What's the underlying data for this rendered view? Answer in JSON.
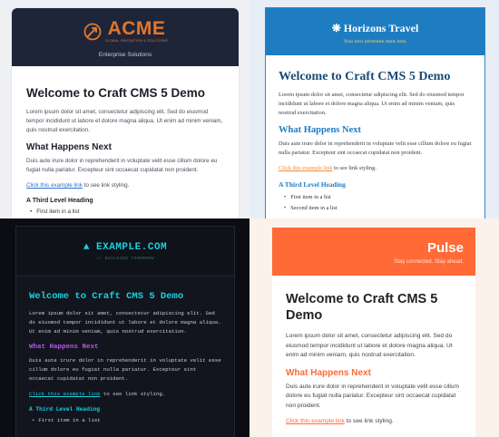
{
  "acme": {
    "logo_word": "ACME",
    "logo_sub": "GLOBAL INNOVATION & SOLUTIONS",
    "tagline": "Enterprise Solutions",
    "heading": "Welcome to Craft CMS 5 Demo",
    "para1": "Lorem ipsum dolor sit amet, consectetur adipiscing elit. Sed do eiusmod tempor incididunt ut labore et dolore magna aliqua. Ut enim ad minim veniam, quis nostrud exercitation.",
    "subheading": "What Happens Next",
    "para2": "Duis aute irure dolor in reprehenderit in voluptate velit esse cillum dolore eu fugiat nulla pariatur. Excepteur sint occaecat cupidatat non proident.",
    "link_text": "Click this example link",
    "link_suffix": " to see link styling.",
    "third_heading": "A Third Level Heading",
    "list": [
      "First item in a list"
    ],
    "accent_color": "#e0772c"
  },
  "horizons": {
    "title": "❋ Horizons Travel",
    "tagline": "Your next adventure starts here.",
    "heading": "Welcome to Craft CMS 5 Demo",
    "para1": "Lorem ipsum dolor sit amet, consectetur adipiscing elit. Sed do eiusmod tempor incididunt ut labore et dolore magna aliqua. Ut enim ad minim veniam, quis nostrud exercitation.",
    "subheading": "What Happens Next",
    "para2": "Duis aute irure dolor in reprehenderit in voluptate velit esse cillum dolore eu fugiat nulla pariatur. Excepteur sint occaecat cupidatat non proident.",
    "link_text": "Click this example link",
    "link_suffix": " to see link styling.",
    "third_heading": "A Third Level Heading",
    "list": [
      "First item in a list",
      "Second item in a list"
    ],
    "accent_color": "#1e7dc1"
  },
  "example": {
    "title": "▲ EXAMPLE.COM",
    "tagline": "// BUILDING TOMORROW",
    "heading": "Welcome to Craft CMS 5 Demo",
    "para1": "Lorem ipsum dolor sit amet, consectetur adipiscing elit. Sed do eiusmod tempor incididunt ut labore et dolore magna aliqua. Ut enim ad minim veniam, quis nostrud exercitation.",
    "subheading": "What Happens Next",
    "para2": "Duis aute irure dolor in reprehenderit in voluptate velit esse cillum dolore eu fugiat nulla pariatur. Excepteur sint occaecat cupidatat non proident.",
    "link_text": "Click this example link",
    "link_suffix": " to see link styling.",
    "third_heading": "A Third Level Heading",
    "list": [
      "First item in a list"
    ],
    "accent_color": "#19d0e4"
  },
  "pulse": {
    "title": "Pulse",
    "tagline": "Stay connected. Stay ahead.",
    "heading": "Welcome to Craft CMS 5 Demo",
    "para1": "Lorem ipsum dolor sit amet, consectetur adipiscing elit. Sed do eiusmod tempor incididunt ut labore et dolore magna aliqua. Ut enim ad minim veniam, quis nostrud exercitation.",
    "subheading": "What Happens Next",
    "para2": "Duis aute irure dolor in reprehenderit in voluptate velit esse cillum dolore eu fugiat nulla pariatur. Excepteur sint occaecat cupidatat non proident.",
    "link_text": "Click this example link",
    "link_suffix": " to see link styling.",
    "accent_color": "#ff6a37"
  }
}
